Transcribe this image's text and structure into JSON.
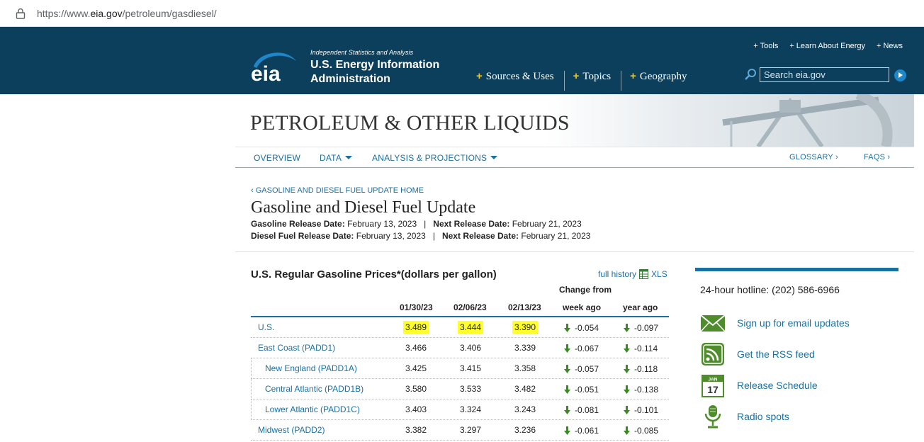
{
  "browser": {
    "url_prefix": "https://www.",
    "url_domain": "eia.gov",
    "url_path": "/petroleum/gasdiesel/"
  },
  "header": {
    "tagline": "Independent Statistics and Analysis",
    "org_line1": "U.S. Energy Information",
    "org_line2": "Administration",
    "logo_text": "eia",
    "top_links": [
      "Tools",
      "Learn About Energy",
      "News"
    ],
    "main_nav": [
      "Sources & Uses",
      "Topics",
      "Geography"
    ],
    "search_placeholder": "Search eia.gov"
  },
  "section": {
    "title": "PETROLEUM & OTHER LIQUIDS",
    "subnav": {
      "overview": "OVERVIEW",
      "data": "DATA",
      "analysis": "ANALYSIS & PROJECTIONS",
      "glossary": "GLOSSARY",
      "faqs": "FAQS"
    }
  },
  "page": {
    "backlink": "‹ GASOLINE AND DIESEL FUEL UPDATE HOME",
    "title": "Gasoline and Diesel Fuel Update",
    "gas_release_label": "Gasoline Release Date:",
    "gas_release_date": "February 13, 2023",
    "gas_next_label": "Next Release Date:",
    "gas_next_date": "February 21, 2023",
    "diesel_release_label": "Diesel Fuel Release Date:",
    "diesel_release_date": "February 13, 2023",
    "diesel_next_label": "Next Release Date:",
    "diesel_next_date": "February 21, 2023",
    "separator": "|"
  },
  "table": {
    "title": "U.S. Regular Gasoline Prices*(dollars per gallon)",
    "full_history": "full history",
    "xls": "XLS",
    "change_from": "Change from",
    "columns": [
      "01/30/23",
      "02/06/23",
      "02/13/23",
      "week ago",
      "year ago"
    ],
    "rows": [
      {
        "label": "U.S.",
        "v1": "3.489",
        "v2": "3.444",
        "v3": "3.390",
        "wk": "-0.054",
        "yr": "-0.097"
      },
      {
        "label": "East Coast (PADD1)",
        "v1": "3.466",
        "v2": "3.406",
        "v3": "3.339",
        "wk": "-0.067",
        "yr": "-0.114"
      },
      {
        "label": "New England (PADD1A)",
        "v1": "3.425",
        "v2": "3.415",
        "v3": "3.358",
        "wk": "-0.057",
        "yr": "-0.118"
      },
      {
        "label": "Central Atlantic (PADD1B)",
        "v1": "3.580",
        "v2": "3.533",
        "v3": "3.482",
        "wk": "-0.051",
        "yr": "-0.138"
      },
      {
        "label": "Lower Atlantic (PADD1C)",
        "v1": "3.403",
        "v2": "3.324",
        "v3": "3.243",
        "wk": "-0.081",
        "yr": "-0.101"
      },
      {
        "label": "Midwest (PADD2)",
        "v1": "3.382",
        "v2": "3.297",
        "v3": "3.236",
        "wk": "-0.061",
        "yr": "-0.085"
      }
    ],
    "highlight_color": "#ffff2b",
    "down_color": "#3a8a24"
  },
  "sidebar": {
    "hotline": "24-hour hotline: (202) 586-6966",
    "links": [
      "Sign up for email updates",
      "Get the RSS feed",
      "Release Schedule",
      "Radio spots"
    ],
    "calendar_month": "JAN",
    "calendar_day": "17"
  },
  "colors": {
    "header_bg": "#0b3f5c",
    "accent_blue": "#1a6fa3",
    "plus_yellow": "#f2c318",
    "icon_green": "#4f8c2c"
  }
}
